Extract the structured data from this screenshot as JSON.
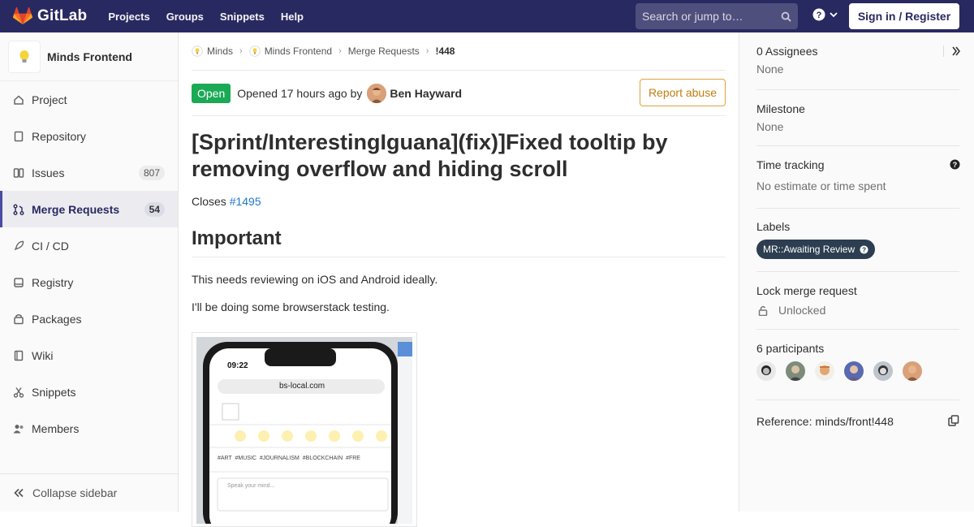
{
  "navbar": {
    "brand": "GitLab",
    "links": [
      "Projects",
      "Groups",
      "Snippets",
      "Help"
    ],
    "search_placeholder": "Search or jump to…",
    "signin_label": "Sign in / Register"
  },
  "sidebar": {
    "project_name": "Minds Frontend",
    "items": [
      {
        "label": "Project",
        "icon": "home-icon"
      },
      {
        "label": "Repository",
        "icon": "doc-icon"
      },
      {
        "label": "Issues",
        "icon": "issues-icon",
        "count": "807"
      },
      {
        "label": "Merge Requests",
        "icon": "merge-icon",
        "count": "54",
        "active": true
      },
      {
        "label": "CI / CD",
        "icon": "rocket-icon"
      },
      {
        "label": "Registry",
        "icon": "container-icon"
      },
      {
        "label": "Packages",
        "icon": "package-icon"
      },
      {
        "label": "Wiki",
        "icon": "book-icon"
      },
      {
        "label": "Snippets",
        "icon": "scissors-icon"
      },
      {
        "label": "Members",
        "icon": "users-icon"
      }
    ],
    "collapse_label": "Collapse sidebar"
  },
  "breadcrumb": {
    "items": [
      "Minds",
      "Minds Frontend",
      "Merge Requests"
    ],
    "current": "!448"
  },
  "mr": {
    "status": "Open",
    "opened_text": "Opened 17 hours ago by",
    "author": "Ben Hayward",
    "report_label": "Report abuse",
    "title": "[Sprint/InterestingIguana](fix)]Fixed tooltip by removing overflow and hiding scroll",
    "closes_prefix": "Closes",
    "closes_link": "#1495",
    "heading": "Important",
    "para1": "This needs reviewing on iOS and Android ideally.",
    "para2": "I'll be doing some browserstack testing."
  },
  "screenshot": {
    "time": "09:22",
    "url": "bs-local.com",
    "tags": "#ART  #MUSIC  #JOURNALISM  #BLOCKCHAIN  #FRE",
    "composer_placeholder": "Speak your mind..."
  },
  "right_sidebar": {
    "assignees_label": "0 Assignees",
    "assignees_value": "None",
    "milestone_label": "Milestone",
    "milestone_value": "None",
    "time_label": "Time tracking",
    "time_value": "No estimate or time spent",
    "labels_label": "Labels",
    "label_pill": "MR::Awaiting Review",
    "lock_label": "Lock merge request",
    "lock_value": "Unlocked",
    "participants_label": "6 participants",
    "reference_label": "Reference: minds/front!448"
  },
  "colors": {
    "navbar": "#292961",
    "status_open": "#1aaa55",
    "link": "#1f78d1",
    "report": "#e2a03a",
    "label_pill": "#2c3e50"
  }
}
